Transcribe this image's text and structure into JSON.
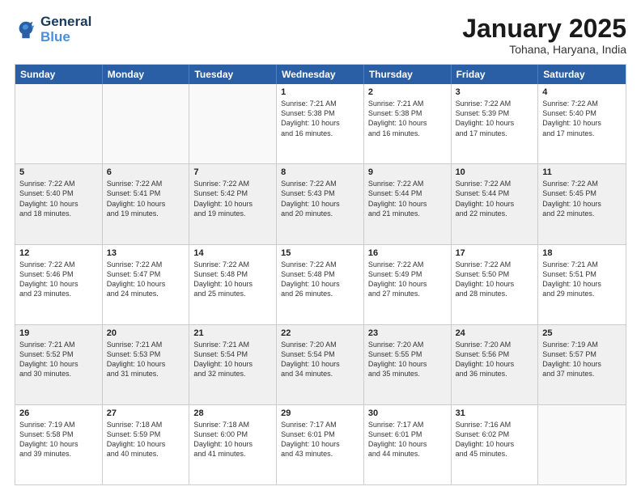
{
  "header": {
    "logo_line1": "General",
    "logo_line2": "Blue",
    "main_title": "January 2025",
    "subtitle": "Tohana, Haryana, India"
  },
  "weekdays": [
    "Sunday",
    "Monday",
    "Tuesday",
    "Wednesday",
    "Thursday",
    "Friday",
    "Saturday"
  ],
  "rows": [
    [
      {
        "day": "",
        "info": ""
      },
      {
        "day": "",
        "info": ""
      },
      {
        "day": "",
        "info": ""
      },
      {
        "day": "1",
        "info": "Sunrise: 7:21 AM\nSunset: 5:38 PM\nDaylight: 10 hours\nand 16 minutes."
      },
      {
        "day": "2",
        "info": "Sunrise: 7:21 AM\nSunset: 5:38 PM\nDaylight: 10 hours\nand 16 minutes."
      },
      {
        "day": "3",
        "info": "Sunrise: 7:22 AM\nSunset: 5:39 PM\nDaylight: 10 hours\nand 17 minutes."
      },
      {
        "day": "4",
        "info": "Sunrise: 7:22 AM\nSunset: 5:40 PM\nDaylight: 10 hours\nand 17 minutes."
      }
    ],
    [
      {
        "day": "5",
        "info": "Sunrise: 7:22 AM\nSunset: 5:40 PM\nDaylight: 10 hours\nand 18 minutes."
      },
      {
        "day": "6",
        "info": "Sunrise: 7:22 AM\nSunset: 5:41 PM\nDaylight: 10 hours\nand 19 minutes."
      },
      {
        "day": "7",
        "info": "Sunrise: 7:22 AM\nSunset: 5:42 PM\nDaylight: 10 hours\nand 19 minutes."
      },
      {
        "day": "8",
        "info": "Sunrise: 7:22 AM\nSunset: 5:43 PM\nDaylight: 10 hours\nand 20 minutes."
      },
      {
        "day": "9",
        "info": "Sunrise: 7:22 AM\nSunset: 5:44 PM\nDaylight: 10 hours\nand 21 minutes."
      },
      {
        "day": "10",
        "info": "Sunrise: 7:22 AM\nSunset: 5:44 PM\nDaylight: 10 hours\nand 22 minutes."
      },
      {
        "day": "11",
        "info": "Sunrise: 7:22 AM\nSunset: 5:45 PM\nDaylight: 10 hours\nand 22 minutes."
      }
    ],
    [
      {
        "day": "12",
        "info": "Sunrise: 7:22 AM\nSunset: 5:46 PM\nDaylight: 10 hours\nand 23 minutes."
      },
      {
        "day": "13",
        "info": "Sunrise: 7:22 AM\nSunset: 5:47 PM\nDaylight: 10 hours\nand 24 minutes."
      },
      {
        "day": "14",
        "info": "Sunrise: 7:22 AM\nSunset: 5:48 PM\nDaylight: 10 hours\nand 25 minutes."
      },
      {
        "day": "15",
        "info": "Sunrise: 7:22 AM\nSunset: 5:48 PM\nDaylight: 10 hours\nand 26 minutes."
      },
      {
        "day": "16",
        "info": "Sunrise: 7:22 AM\nSunset: 5:49 PM\nDaylight: 10 hours\nand 27 minutes."
      },
      {
        "day": "17",
        "info": "Sunrise: 7:22 AM\nSunset: 5:50 PM\nDaylight: 10 hours\nand 28 minutes."
      },
      {
        "day": "18",
        "info": "Sunrise: 7:21 AM\nSunset: 5:51 PM\nDaylight: 10 hours\nand 29 minutes."
      }
    ],
    [
      {
        "day": "19",
        "info": "Sunrise: 7:21 AM\nSunset: 5:52 PM\nDaylight: 10 hours\nand 30 minutes."
      },
      {
        "day": "20",
        "info": "Sunrise: 7:21 AM\nSunset: 5:53 PM\nDaylight: 10 hours\nand 31 minutes."
      },
      {
        "day": "21",
        "info": "Sunrise: 7:21 AM\nSunset: 5:54 PM\nDaylight: 10 hours\nand 32 minutes."
      },
      {
        "day": "22",
        "info": "Sunrise: 7:20 AM\nSunset: 5:54 PM\nDaylight: 10 hours\nand 34 minutes."
      },
      {
        "day": "23",
        "info": "Sunrise: 7:20 AM\nSunset: 5:55 PM\nDaylight: 10 hours\nand 35 minutes."
      },
      {
        "day": "24",
        "info": "Sunrise: 7:20 AM\nSunset: 5:56 PM\nDaylight: 10 hours\nand 36 minutes."
      },
      {
        "day": "25",
        "info": "Sunrise: 7:19 AM\nSunset: 5:57 PM\nDaylight: 10 hours\nand 37 minutes."
      }
    ],
    [
      {
        "day": "26",
        "info": "Sunrise: 7:19 AM\nSunset: 5:58 PM\nDaylight: 10 hours\nand 39 minutes."
      },
      {
        "day": "27",
        "info": "Sunrise: 7:18 AM\nSunset: 5:59 PM\nDaylight: 10 hours\nand 40 minutes."
      },
      {
        "day": "28",
        "info": "Sunrise: 7:18 AM\nSunset: 6:00 PM\nDaylight: 10 hours\nand 41 minutes."
      },
      {
        "day": "29",
        "info": "Sunrise: 7:17 AM\nSunset: 6:01 PM\nDaylight: 10 hours\nand 43 minutes."
      },
      {
        "day": "30",
        "info": "Sunrise: 7:17 AM\nSunset: 6:01 PM\nDaylight: 10 hours\nand 44 minutes."
      },
      {
        "day": "31",
        "info": "Sunrise: 7:16 AM\nSunset: 6:02 PM\nDaylight: 10 hours\nand 45 minutes."
      },
      {
        "day": "",
        "info": ""
      }
    ]
  ]
}
